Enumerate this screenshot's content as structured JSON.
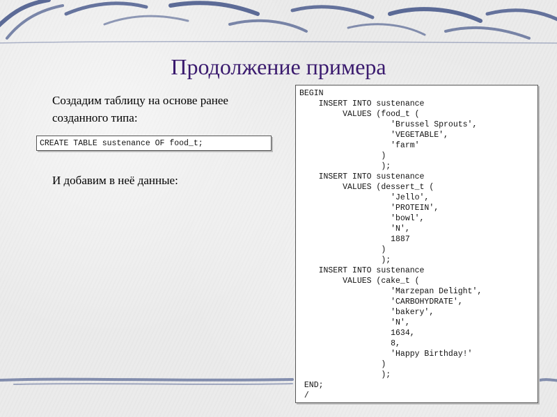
{
  "slide": {
    "title": "Продолжение примера",
    "intro_text": "Создадим таблицу на основе ранее созданного типа:",
    "create_statement": "CREATE TABLE sustenance OF food_t;",
    "second_text": "И добавим в неё данные:",
    "code_block": "BEGIN\n    INSERT INTO sustenance\n         VALUES (food_t (\n                   'Brussel Sprouts',\n                   'VEGETABLE',\n                   'farm'\n                 )\n                 );\n    INSERT INTO sustenance\n         VALUES (dessert_t (\n                   'Jello',\n                   'PROTEIN',\n                   'bowl',\n                   'N',\n                   1887\n                 )\n                 );\n    INSERT INTO sustenance\n         VALUES (cake_t (\n                   'Marzepan Delight',\n                   'CARBOHYDRATE',\n                   'bakery',\n                   'N',\n                   1634,\n                   8,\n                   'Happy Birthday!'\n                 )\n                 );\n END;\n /"
  },
  "colors": {
    "title": "#3a1a6e",
    "decor_stroke": "#2b3f7a"
  }
}
